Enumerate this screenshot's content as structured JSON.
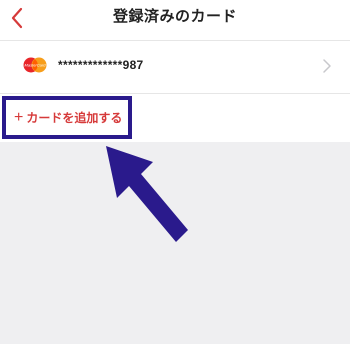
{
  "navbar": {
    "title": "登録済みのカード",
    "back_icon": "chevron-left-icon"
  },
  "card": {
    "brand": "MasterCard",
    "brand_logo_text": "MasterCard",
    "number": "*************987",
    "chevron_icon": "chevron-right-icon"
  },
  "add_card": {
    "plus": "+",
    "label": "カードを追加する"
  },
  "annotation": {
    "arrow_icon": "pointer-arrow-icon",
    "highlight_color": "#2a1a8c"
  },
  "colors": {
    "accent_red": "#d63a3a",
    "annotation_purple": "#2a1a8c",
    "background": "#efeff1"
  }
}
